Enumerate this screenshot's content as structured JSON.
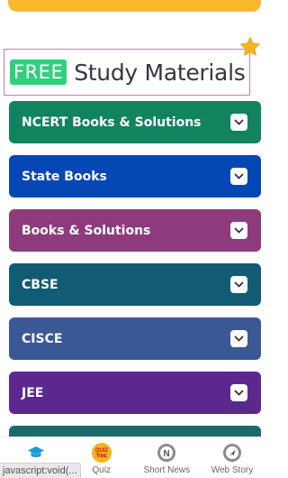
{
  "header": {
    "badge": "FREE",
    "title": "Study Materials"
  },
  "categories": [
    {
      "label": "NCERT Books & Solutions",
      "color": "#12835f"
    },
    {
      "label": "State Books",
      "color": "#0547b4"
    },
    {
      "label": "Books & Solutions",
      "color": "#8e3b7e"
    },
    {
      "label": "CBSE",
      "color": "#125b74"
    },
    {
      "label": "CISCE",
      "color": "#3b5896"
    },
    {
      "label": "JEE",
      "color": "#5b2890"
    },
    {
      "label": "",
      "color": "#1c6b6a"
    }
  ],
  "nav": {
    "items": [
      {
        "label": "",
        "icon": "graduation-cap-icon"
      },
      {
        "label": "Quiz",
        "icon": "quiz-time-icon"
      },
      {
        "label": "Short News",
        "icon": "news-icon"
      },
      {
        "label": "Web Story",
        "icon": "web-story-icon"
      }
    ]
  },
  "status_bar": {
    "link": "javascript:void(..."
  },
  "colors": {
    "accent": "#f9b82b",
    "badge": "#2fcf7c"
  }
}
